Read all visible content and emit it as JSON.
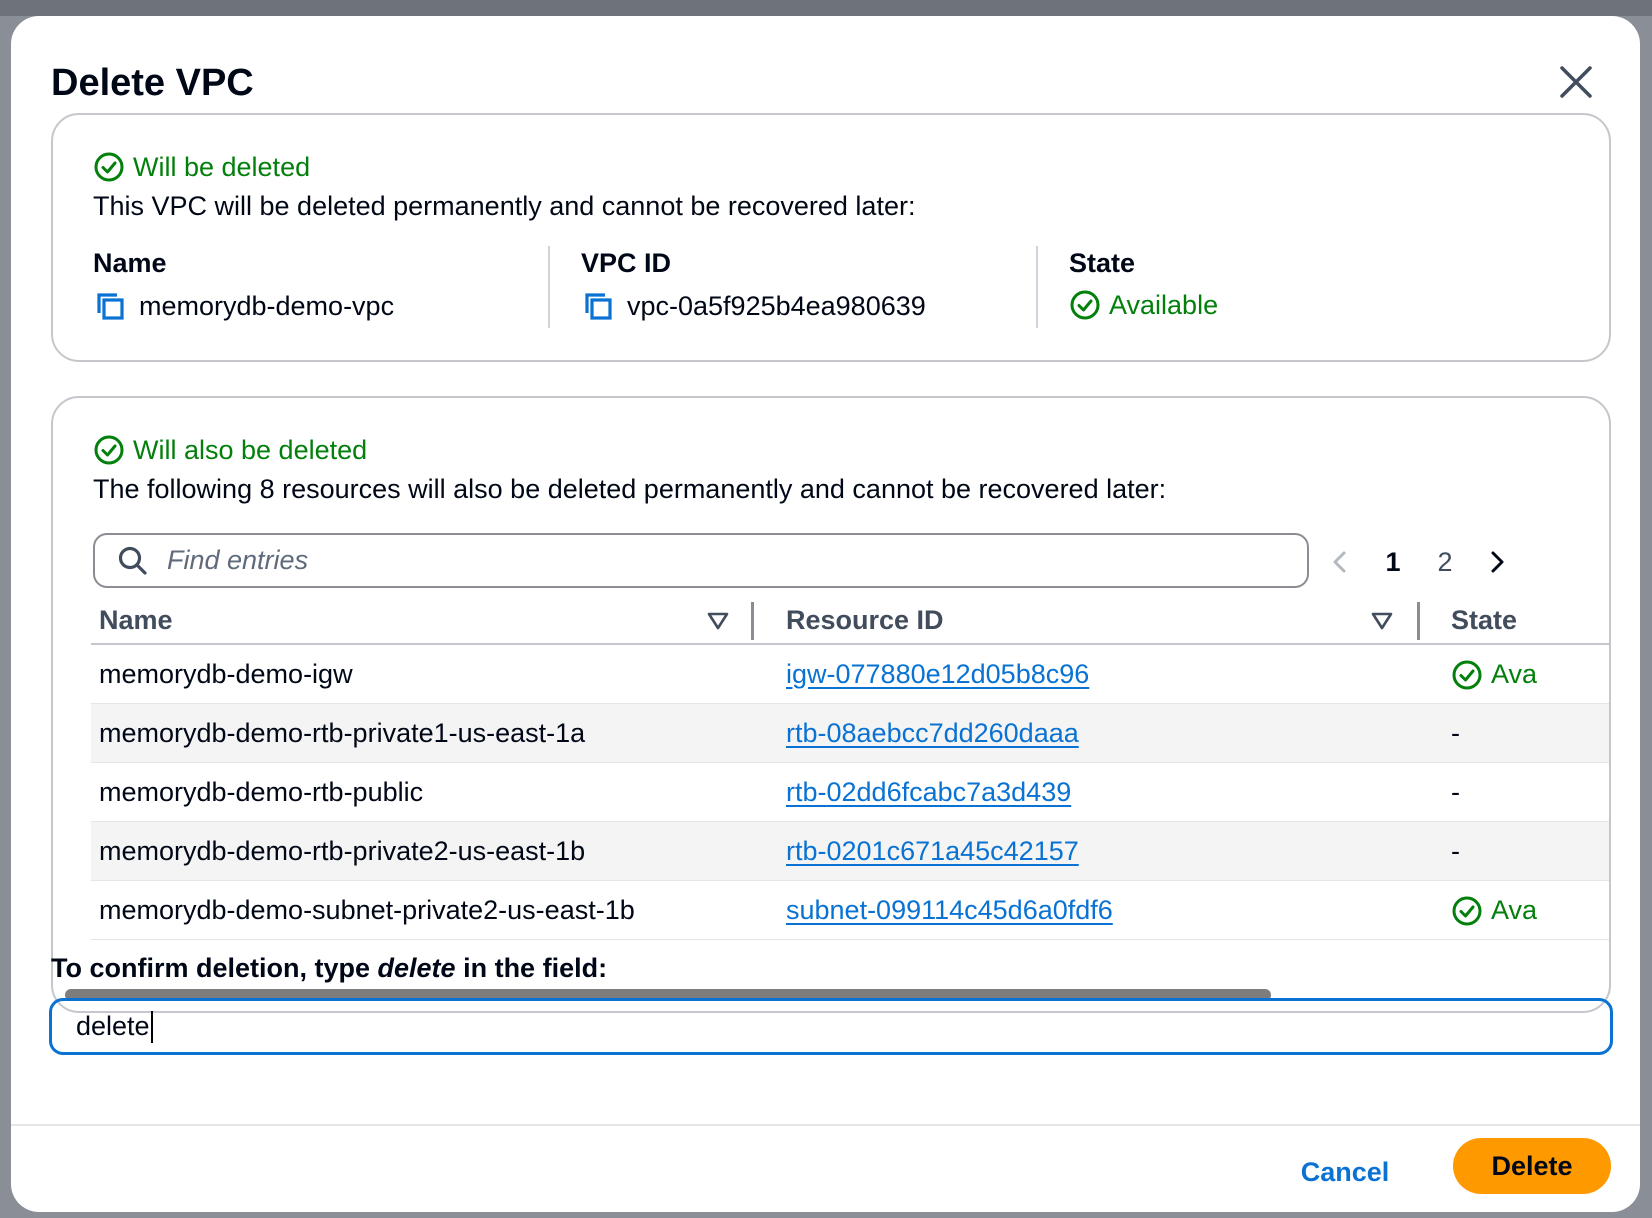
{
  "dialog": {
    "title": "Delete VPC",
    "close_icon": "close-icon"
  },
  "vpc_card": {
    "status": "Will be deleted",
    "description": "This VPC will be deleted permanently and cannot be recovered later:",
    "name_label": "Name",
    "name_value": "memorydb-demo-vpc",
    "vpcid_label": "VPC ID",
    "vpcid_value": "vpc-0a5f925b4ea980639",
    "state_label": "State",
    "state_value": "Available"
  },
  "resources_card": {
    "status": "Will also be deleted",
    "description": "The following 8 resources will also be deleted permanently and cannot be recovered later:",
    "search_placeholder": "Find entries",
    "pagination": {
      "pages": [
        "1",
        "2"
      ],
      "current": "1"
    },
    "columns": [
      "Name",
      "Resource ID",
      "State"
    ],
    "rows": [
      {
        "name": "memorydb-demo-igw",
        "resource_id": "igw-077880e12d05b8c96",
        "state": "Ava",
        "state_ok": true
      },
      {
        "name": "memorydb-demo-rtb-private1-us-east-1a",
        "resource_id": "rtb-08aebcc7dd260daaa",
        "state": "-",
        "state_ok": false
      },
      {
        "name": "memorydb-demo-rtb-public",
        "resource_id": "rtb-02dd6fcabc7a3d439",
        "state": "-",
        "state_ok": false
      },
      {
        "name": "memorydb-demo-rtb-private2-us-east-1b",
        "resource_id": "rtb-0201c671a45c42157",
        "state": "-",
        "state_ok": false
      },
      {
        "name": "memorydb-demo-subnet-private2-us-east-1b",
        "resource_id": "subnet-099114c45d6a0fdf6",
        "state": "Ava",
        "state_ok": true
      }
    ]
  },
  "confirm": {
    "label_before": "To confirm deletion, type ",
    "label_keyword": "delete",
    "label_after": " in the field:",
    "input_value": "delete"
  },
  "footer": {
    "cancel_label": "Cancel",
    "delete_label": "Delete"
  },
  "colors": {
    "success": "#037f0c",
    "link": "#0972d3",
    "primary_button": "#ff9900"
  }
}
